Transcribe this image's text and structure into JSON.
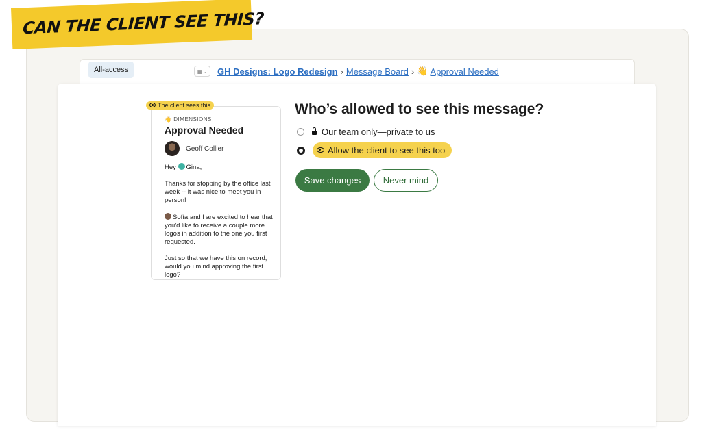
{
  "banner": {
    "text": "CAN THE CLIENT SEE THIS?"
  },
  "topbar": {
    "access_tag": "All-access",
    "breadcrumb": {
      "project": "GH Designs: Logo Redesign",
      "separator": "›",
      "tool": "Message Board",
      "message_emoji": "👋",
      "message": "Approval Needed"
    }
  },
  "preview": {
    "badge": "The client sees this",
    "board_emoji": "👋",
    "board": "DIMENSIONS",
    "title": "Approval Needed",
    "author": "Geoff Collier",
    "greeting_prefix": "Hey",
    "greeting_name": "Gina,",
    "para1": "Thanks for stopping by the office last week -- it was nice to meet you in person!",
    "para2": "Sofía and I are excited to hear that you'd like to receive a couple more logos in addition to the one you first requested.",
    "para3": "Just so that we have this on record, would you mind approving the first logo?"
  },
  "form": {
    "question": "Who’s allowed to see this message?",
    "options": [
      {
        "label": "Our team only—private to us",
        "icon": "lock-icon",
        "selected": false
      },
      {
        "label": "Allow the client to see this too",
        "icon": "eye-icon",
        "selected": true
      }
    ],
    "save_label": "Save changes",
    "cancel_label": "Never mind"
  },
  "colors": {
    "banner": "#f4c92b",
    "highlight": "#f5d24e",
    "primary_button": "#3b7a43",
    "link": "#2d6fc2",
    "background": "#f6f5f1"
  }
}
